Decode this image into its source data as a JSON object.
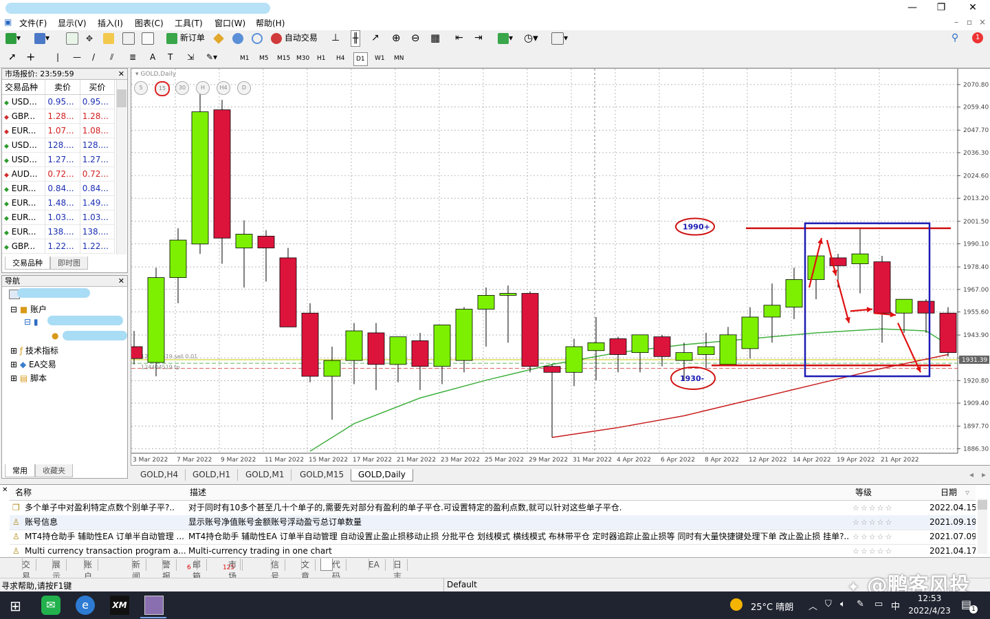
{
  "window": {
    "minimize": "—",
    "restore": "❐",
    "close": "✕"
  },
  "menu": [
    "文件(F)",
    "显示(V)",
    "插入(I)",
    "图表(C)",
    "工具(T)",
    "窗口(W)",
    "帮助(H)"
  ],
  "toolbar": {
    "new_order": "新订单",
    "auto_trade": "自动交易",
    "notify_count": "1"
  },
  "timeframes": [
    "M1",
    "M5",
    "M15",
    "M30",
    "H1",
    "H4",
    "D1",
    "W1",
    "MN"
  ],
  "active_timeframe": "D1",
  "market_watch": {
    "title": "市场报价: 23:59:59",
    "headers": [
      "交易品种",
      "卖价",
      "买价"
    ],
    "rows": [
      {
        "sym": "USD...",
        "bid": "0.95...",
        "ask": "0.95...",
        "dir": "up"
      },
      {
        "sym": "GBP...",
        "bid": "1.28...",
        "ask": "1.28...",
        "dir": "down"
      },
      {
        "sym": "EUR...",
        "bid": "1.07...",
        "ask": "1.08...",
        "dir": "down"
      },
      {
        "sym": "USD...",
        "bid": "128....",
        "ask": "128....",
        "dir": "up"
      },
      {
        "sym": "USD...",
        "bid": "1.27...",
        "ask": "1.27...",
        "dir": "up"
      },
      {
        "sym": "AUD...",
        "bid": "0.72...",
        "ask": "0.72...",
        "dir": "down"
      },
      {
        "sym": "EUR...",
        "bid": "0.84...",
        "ask": "0.84...",
        "dir": "up"
      },
      {
        "sym": "EUR...",
        "bid": "1.48...",
        "ask": "1.49...",
        "dir": "up"
      },
      {
        "sym": "EUR...",
        "bid": "1.03...",
        "ask": "1.03...",
        "dir": "up"
      },
      {
        "sym": "EUR...",
        "bid": "138....",
        "ask": "138....",
        "dir": "up"
      },
      {
        "sym": "GBP...",
        "bid": "1.22...",
        "ask": "1.22...",
        "dir": "up"
      }
    ],
    "tabs": [
      "交易品种",
      "即时图"
    ]
  },
  "navigator": {
    "title": "导航",
    "items": [
      "账户",
      "技术指标",
      "EA交易",
      "脚本"
    ],
    "tabs": [
      "常用",
      "收藏夹"
    ]
  },
  "chart": {
    "symbol_label": "GOLD,Daily",
    "position_label1": "124404519 sell 0.01",
    "position_label2": "124404519 tp",
    "price_ticks": [
      "2070.80",
      "2059.40",
      "2047.70",
      "2036.30",
      "2024.60",
      "2013.20",
      "2001.50",
      "1990.10",
      "1978.40",
      "1967.00",
      "1955.60",
      "1943.90",
      "1932.20",
      "1920.80",
      "1909.40",
      "1897.70",
      "1886.30"
    ],
    "current_price": "1931.39",
    "date_ticks": [
      "3 Mar 2022",
      "7 Mar 2022",
      "9 Mar 2022",
      "11 Mar 2022",
      "15 Mar 2022",
      "17 Mar 2022",
      "21 Mar 2022",
      "23 Mar 2022",
      "25 Mar 2022",
      "29 Mar 2022",
      "31 Mar 2022",
      "4 Apr 2022",
      "6 Apr 2022",
      "8 Apr 2022",
      "12 Apr 2022",
      "14 Apr 2022",
      "19 Apr 2022",
      "21 Apr 2022"
    ],
    "tf_buttons": [
      "5",
      "15",
      "30",
      "H",
      "H4",
      "D"
    ],
    "annotation_top": "1990+",
    "annotation_bottom": "1930-",
    "candles": [
      [
        1938,
        1946,
        1929,
        1932
      ],
      [
        1930,
        1978,
        1923,
        1973
      ],
      [
        1973,
        1998,
        1960,
        1992
      ],
      [
        1990,
        2070,
        1985,
        2057
      ],
      [
        2058,
        2063,
        1980,
        1993
      ],
      [
        1988,
        2002,
        1968,
        1995
      ],
      [
        1994,
        1997,
        1971,
        1988
      ],
      [
        1983,
        1988,
        1955,
        1948
      ],
      [
        1955,
        1960,
        1920,
        1923
      ],
      [
        1923,
        1938,
        1901,
        1931
      ],
      [
        1931,
        1950,
        1919,
        1946
      ],
      [
        1945,
        1950,
        1916,
        1929
      ],
      [
        1929,
        1943,
        1920,
        1943
      ],
      [
        1941,
        1945,
        1916,
        1928
      ],
      [
        1928,
        1947,
        1919,
        1949
      ],
      [
        1931,
        1958,
        1925,
        1957
      ],
      [
        1957,
        1968,
        1938,
        1964
      ],
      [
        1964,
        1969,
        1940,
        1965
      ],
      [
        1965,
        1966,
        1925,
        1928
      ],
      [
        1928,
        1929,
        1892,
        1925
      ],
      [
        1925,
        1942,
        1918,
        1938
      ],
      [
        1936,
        1953,
        1921,
        1940
      ],
      [
        1942,
        1943,
        1925,
        1934
      ],
      [
        1935,
        1942,
        1925,
        1944
      ],
      [
        1943,
        1944,
        1928,
        1933
      ],
      [
        1931,
        1940,
        1921,
        1935
      ],
      [
        1934,
        1945,
        1927,
        1938
      ],
      [
        1929,
        1948,
        1930,
        1944
      ],
      [
        1937,
        1958,
        1932,
        1953
      ],
      [
        1953,
        1970,
        1940,
        1959
      ],
      [
        1958,
        1978,
        1952,
        1972
      ],
      [
        1972,
        1983,
        1962,
        1984
      ],
      [
        1983,
        1985,
        1968,
        1979
      ],
      [
        1980,
        1998,
        1965,
        1985
      ],
      [
        1981,
        1984,
        1940,
        1955
      ],
      [
        1955,
        1962,
        1945,
        1962
      ],
      [
        1961,
        1962,
        1945,
        1955
      ],
      [
        1955,
        1958,
        1933,
        1935
      ]
    ],
    "ma_green": [
      [
        8,
        1885
      ],
      [
        10,
        1899
      ],
      [
        13,
        1912
      ],
      [
        16,
        1921
      ],
      [
        19,
        1929
      ],
      [
        22,
        1935
      ],
      [
        25,
        1939
      ],
      [
        28,
        1942
      ],
      [
        31,
        1945
      ],
      [
        34,
        1947
      ],
      [
        35,
        1946.5
      ],
      [
        36,
        1946
      ],
      [
        37,
        1939
      ]
    ],
    "ma_red": [
      [
        19,
        1892
      ],
      [
        22,
        1897
      ],
      [
        25,
        1903
      ],
      [
        28,
        1911
      ],
      [
        31,
        1919
      ],
      [
        34,
        1927
      ],
      [
        37,
        1934
      ]
    ]
  },
  "chart_tabs": [
    "GOLD,H4",
    "GOLD,H1",
    "GOLD,M1",
    "GOLD,M15",
    "GOLD,Daily"
  ],
  "codebase": {
    "headers": {
      "name": "名称",
      "desc": "描述",
      "rating": "等级",
      "date": "日期"
    },
    "rows": [
      {
        "name": "多个单子中对盈利特定点数个别单子平?..",
        "desc": "对于同时有10多个甚至几十个单子的,需要先对部分有盈利的单子平仓.可设置特定的盈利点数,就可以针对这些单子平仓.",
        "date": "2022.04.15"
      },
      {
        "name": "账号信息",
        "desc": "显示账号净值账号金额账号浮动盈亏总订单数量",
        "date": "2021.09.19"
      },
      {
        "name": "MT4持仓助手 辅助性EA 订单半自动管理 ...",
        "desc": "MT4持仓助手 辅助性EA 订单半自动管理 自动设置止盈止损移动止损 分批平仓 划线模式 横线模式 布林带平仓 定时器追踪止盈止损等 同时有大量快捷键处理下单 改止盈止损 挂单?...",
        "date": "2021.07.09"
      },
      {
        "name": "Multi currency transaction program a...",
        "desc": "Multi-currency trading in one chart",
        "date": "2021.04.17"
      }
    ]
  },
  "bottom_tabs": [
    {
      "label": "交易",
      "badge": ""
    },
    {
      "label": "展示",
      "badge": ""
    },
    {
      "label": "账户历史",
      "badge": ""
    },
    {
      "label": "新闻",
      "badge": ""
    },
    {
      "label": "警报",
      "badge": ""
    },
    {
      "label": "邮箱",
      "badge": "6"
    },
    {
      "label": "市场",
      "badge": "125"
    },
    {
      "label": "信号",
      "badge": ""
    },
    {
      "label": "文章",
      "badge": ""
    },
    {
      "label": "代码库",
      "badge": ""
    },
    {
      "label": "EA",
      "badge": ""
    },
    {
      "label": "日志",
      "badge": ""
    }
  ],
  "status": {
    "help": "寻求帮助,请按F1键",
    "profile": "Default"
  },
  "taskbar": {
    "weather": "25°C 晴朗",
    "ime": "中",
    "time": "12:53",
    "date": "2022/4/23",
    "watermark": "@鹏客风投",
    "notif_count": "1"
  }
}
